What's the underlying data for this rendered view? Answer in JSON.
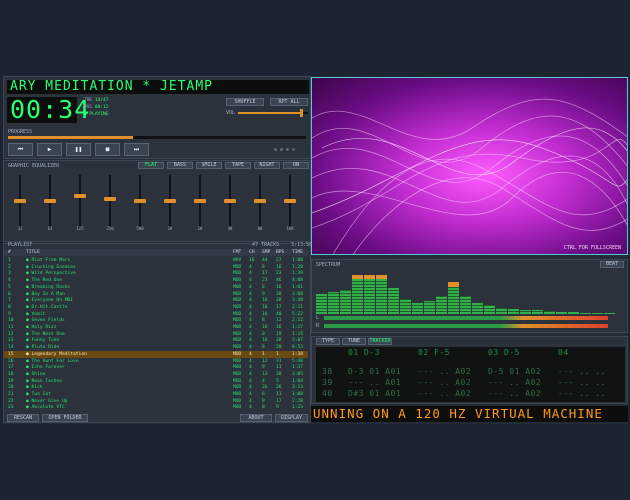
{
  "player": {
    "title_scroll": "ARY MEDITATION  *  JETAMP",
    "time": "00:34",
    "info": [
      {
        "k": "TRK",
        "v": "14/47"
      },
      {
        "k": "POS",
        "v": "00:12"
      },
      {
        "k": "",
        "v": "PLAYING"
      }
    ],
    "shuffle_label": "SHUFFLE",
    "repeat_label": "RPT ALL",
    "vol_label": "VOL",
    "volume": 0.92,
    "progress_label": "PROGRESS",
    "progress": 0.42,
    "transport": [
      "⏮",
      "▶",
      "❚❚",
      "■",
      "⏭"
    ],
    "transport_names": [
      "prev",
      "play",
      "pause",
      "stop",
      "next"
    ],
    "right_icons": "⊕ ⊗ ⊛ ⊘"
  },
  "eq": {
    "label": "GRAPHIC EQUALIZER",
    "presets": [
      "FLAT",
      "BASS",
      "SMILE",
      "TAPE",
      "NIGHT",
      "ON"
    ],
    "bands": [
      "31",
      "63",
      "125",
      "250",
      "500",
      "1K",
      "2K",
      "4K",
      "8K",
      "16K"
    ],
    "levels": [
      0.5,
      0.5,
      0.6,
      0.55,
      0.5,
      0.5,
      0.5,
      0.5,
      0.5,
      0.5
    ]
  },
  "playlist": {
    "label": "PLAYLIST",
    "count": "47 TRACKS",
    "total": "3:13:56",
    "cols": [
      "#",
      "TITLE",
      "FMT",
      "CH",
      "SMP",
      "BPS",
      "TIME"
    ],
    "rows": [
      {
        "n": "1",
        "t": "Riot From Mars",
        "f": "WAV",
        "c": "16",
        "s": "44",
        "b": "27",
        "d": "1:00"
      },
      {
        "n": "2",
        "t": "Crushing Enemies",
        "f": "MOD",
        "c": "4",
        "s": "8",
        "b": "16",
        "d": "1:28"
      },
      {
        "n": "3",
        "t": "Wild Perspective",
        "f": "MOD",
        "c": "4",
        "s": "17",
        "b": "23",
        "d": "1:39"
      },
      {
        "n": "4",
        "t": "The Red One",
        "f": "MOD",
        "c": "4",
        "s": "23",
        "b": "46",
        "d": "4:08"
      },
      {
        "n": "5",
        "t": "Breaking Rocks",
        "f": "MOD",
        "c": "4",
        "s": "8",
        "b": "16",
        "d": "1:01"
      },
      {
        "n": "6",
        "t": "Boy In A Man",
        "f": "MOD",
        "c": "4",
        "s": "9",
        "b": "28",
        "d": "3:08"
      },
      {
        "n": "7",
        "t": "Everyone On MDI",
        "f": "MOD",
        "c": "4",
        "s": "16",
        "b": "28",
        "d": "3:48"
      },
      {
        "n": "8",
        "t": "Dr.Hit.Castle",
        "f": "MOD",
        "c": "4",
        "s": "16",
        "b": "17",
        "d": "2:11"
      },
      {
        "n": "9",
        "t": "Vomit",
        "f": "MOD",
        "c": "4",
        "s": "16",
        "b": "40",
        "d": "5:22"
      },
      {
        "n": "10",
        "t": "Seven Fields",
        "f": "MOD",
        "c": "4",
        "s": "8",
        "b": "12",
        "d": "2:12"
      },
      {
        "n": "11",
        "t": "Holy Rizz",
        "f": "MOD",
        "c": "4",
        "s": "16",
        "b": "16",
        "d": "1:17"
      },
      {
        "n": "12",
        "t": "The Next One",
        "f": "MOD",
        "c": "4",
        "s": "8",
        "b": "19",
        "d": "1:15"
      },
      {
        "n": "13",
        "t": "Funny Tune",
        "f": "MOD",
        "c": "4",
        "s": "16",
        "b": "28",
        "d": "2:07"
      },
      {
        "n": "14",
        "t": "Pluto Ride",
        "f": "MOD",
        "c": "4",
        "s": "8",
        "b": "28",
        "d": "0:53"
      },
      {
        "n": "15",
        "t": "Legendary Meditation",
        "f": "MOD",
        "c": "4",
        "s": "1",
        "b": "1",
        "d": "1:38"
      },
      {
        "n": "16",
        "t": "The Hunt For Love",
        "f": "MOD",
        "c": "4",
        "s": "12",
        "b": "31",
        "d": "5:48"
      },
      {
        "n": "17",
        "t": "Echo Forever",
        "f": "MOD",
        "c": "4",
        "s": "9",
        "b": "11",
        "d": "1:37"
      },
      {
        "n": "18",
        "t": "Shine",
        "f": "MOD",
        "c": "4",
        "s": "13",
        "b": "28",
        "d": "3:05"
      },
      {
        "n": "19",
        "t": "Neon Techno",
        "f": "MOD",
        "c": "4",
        "s": "4",
        "b": "5",
        "d": "1:04"
      },
      {
        "n": "20",
        "t": "Kick",
        "f": "MOD",
        "c": "4",
        "s": "26",
        "b": "26",
        "d": "3:13"
      },
      {
        "n": "21",
        "t": "Two Cat",
        "f": "MOD",
        "c": "4",
        "s": "6",
        "b": "11",
        "d": "1:08"
      },
      {
        "n": "22",
        "t": "Never Give Up",
        "f": "MOD",
        "c": "4",
        "s": "8",
        "b": "17",
        "d": "2:28"
      },
      {
        "n": "23",
        "t": "Absolute VTC",
        "f": "MOD",
        "c": "4",
        "s": "8",
        "b": "9",
        "d": "1:23"
      }
    ],
    "selected": 14,
    "buttons": [
      "RESCAN",
      "OPEN FOLDER",
      "ABOUT",
      "DISPLAY"
    ]
  },
  "viz": {
    "caption": "CTRL FOR FULLSCREEN"
  },
  "spectrum": {
    "label": "SPECTRUM",
    "mode": "BEAT",
    "bars": [
      0.45,
      0.5,
      0.55,
      0.8,
      0.8,
      0.8,
      0.6,
      0.35,
      0.25,
      0.3,
      0.4,
      0.62,
      0.42,
      0.26,
      0.2,
      0.14,
      0.12,
      0.1,
      0.08,
      0.06,
      0.05,
      0.04,
      0.03,
      0.03,
      0.02
    ],
    "peaks": [
      0.45,
      0.5,
      0.55,
      0.88,
      0.88,
      0.88,
      0.6,
      0.35,
      0.25,
      0.3,
      0.4,
      0.72,
      0.42,
      0.26,
      0.2,
      0.14,
      0.12,
      0.1,
      0.08,
      0.06,
      0.05,
      0.04,
      0.03,
      0.03,
      0.02
    ],
    "vu": [
      {
        "ch": "L",
        "level": 0.96
      },
      {
        "ch": "R",
        "level": 0.96
      }
    ]
  },
  "tracker": {
    "tabs": [
      "TYPE",
      "TUNE",
      "TRACKER"
    ],
    "header": [
      "01 D-3",
      "02 F-5",
      "03 D-5",
      "04"
    ],
    "rows": [
      {
        "n": "38",
        "c": [
          "D-3 01 A01",
          "--- .. A02",
          "D-5 01 A02",
          "--- .. .."
        ]
      },
      {
        "n": "39",
        "c": [
          "--- .. A01",
          "--- .. A02",
          "--- .. A02",
          "--- .. .."
        ]
      },
      {
        "n": "40",
        "c": [
          "D#3 01 A01",
          "--- .. A02",
          "--- .. A02",
          "--- .. .."
        ]
      }
    ]
  },
  "marquee": "UNNING ON A 120 HZ VIRTUAL MACHINE",
  "colors": {
    "lcd_green": "#29ff73",
    "accent_orange": "#e0902a",
    "viz_border": "#55c8d6"
  }
}
